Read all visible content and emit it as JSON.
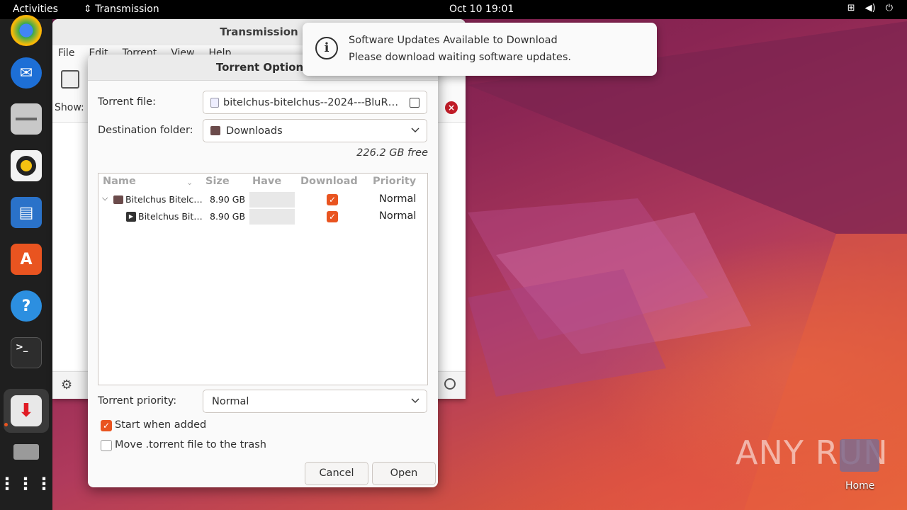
{
  "topbar": {
    "activities": "Activities",
    "app_name": "Transmission",
    "clock": "Oct 10  19:01",
    "tray_icons": [
      "network-icon",
      "volume-icon",
      "power-icon"
    ]
  },
  "dock": {
    "items": [
      "chrome-icon",
      "thunderbird-icon",
      "files-icon",
      "rhythmbox-icon",
      "writer-icon",
      "app-center-icon",
      "help-icon",
      "terminal-icon",
      "transmission-icon",
      "disk-icon",
      "apps-grid-icon"
    ]
  },
  "main_window": {
    "title": "Transmission",
    "menu": [
      "File",
      "Edit",
      "Torrent",
      "View",
      "Help"
    ],
    "show_label": "Show:"
  },
  "dialog": {
    "title": "Torrent Options",
    "torrent_file_label": "Torrent file:",
    "torrent_file_value": "bitelchus-bitelchus--2024---BluR…",
    "destination_label": "Destination folder:",
    "destination_value": "Downloads",
    "free_space": "226.2 GB free",
    "columns": {
      "name": "Name",
      "size": "Size",
      "have": "Have",
      "download": "Download",
      "priority": "Priority"
    },
    "files": [
      {
        "name": "Bitelchus Bitelc…",
        "size": "8.90 GB",
        "priority": "Normal",
        "type": "folder"
      },
      {
        "name": "Bitelchus Bit…",
        "size": "8.90 GB",
        "priority": "Normal",
        "type": "video"
      }
    ],
    "priority_label": "Torrent priority:",
    "priority_value": "Normal",
    "start_when_added": "Start when added",
    "move_to_trash": "Move .torrent file to the trash",
    "cancel": "Cancel",
    "open": "Open"
  },
  "notification": {
    "title": "Software Updates Available to Download",
    "body": "Please download waiting software updates."
  },
  "desktop": {
    "home_label": "Home",
    "watermark": "ANY RUN"
  },
  "colors": {
    "accent": "#e95420",
    "topbar": "#000000",
    "dock": "#1f1f1f"
  }
}
